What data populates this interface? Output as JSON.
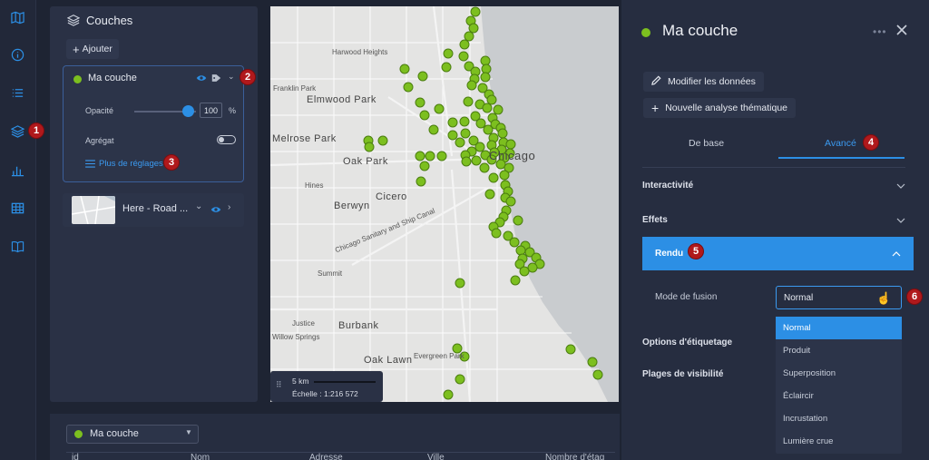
{
  "colors": {
    "accent": "#2c8fe5",
    "green": "#7cbf1f",
    "badge": "#b0191c",
    "panel": "#2a3145"
  },
  "rail": {
    "icons": [
      "map-icon",
      "info-icon",
      "list-icon",
      "layers-icon",
      "chart-icon",
      "table-icon",
      "book-icon"
    ]
  },
  "badges": [
    "1",
    "2",
    "3",
    "4",
    "5",
    "6"
  ],
  "layers": {
    "title": "Couches",
    "add_label": "Ajouter",
    "layer": {
      "name": "Ma couche",
      "opacity_label": "Opacité",
      "opacity_value": "100",
      "opacity_unit": "%",
      "opacity_fraction": 1.0,
      "aggregate_label": "Agrégat",
      "more_settings": "Plus de réglages"
    },
    "basemap": {
      "name": "Here - Road ..."
    }
  },
  "map": {
    "labels": [
      "Harwood Heights",
      "Franklin Park",
      "Elmwood Park",
      "Melrose Park",
      "Oak Park",
      "Berwyn",
      "Cicero",
      "Summit",
      "Burbank",
      "Justice",
      "Oak Lawn",
      "Evergreen Park",
      "Chicago Sanitary and Ship Canal",
      "Hines",
      "Willow Springs",
      "Chicago"
    ],
    "scale_distance": "5 km",
    "scale_text": "Échelle : 1:216 572"
  },
  "table": {
    "layer_select": "Ma couche",
    "columns": [
      "id",
      "Nom",
      "Adresse",
      "Ville",
      "Nombre d'étag"
    ]
  },
  "right": {
    "title": "Ma couche",
    "edit_data": "Modifier les données",
    "new_analysis": "Nouvelle analyse thématique",
    "tab_basic": "De base",
    "tab_advanced": "Avancé",
    "sections": [
      "Interactivité",
      "Effets",
      "Rendu",
      "Options d'étiquetage",
      "Plages de visibilité"
    ],
    "blend_label": "Mode de fusion",
    "blend_value": "Normal",
    "blend_options": [
      "Normal",
      "Produit",
      "Superposition",
      "Éclaircir",
      "Incrustation",
      "Lumière crue"
    ]
  }
}
